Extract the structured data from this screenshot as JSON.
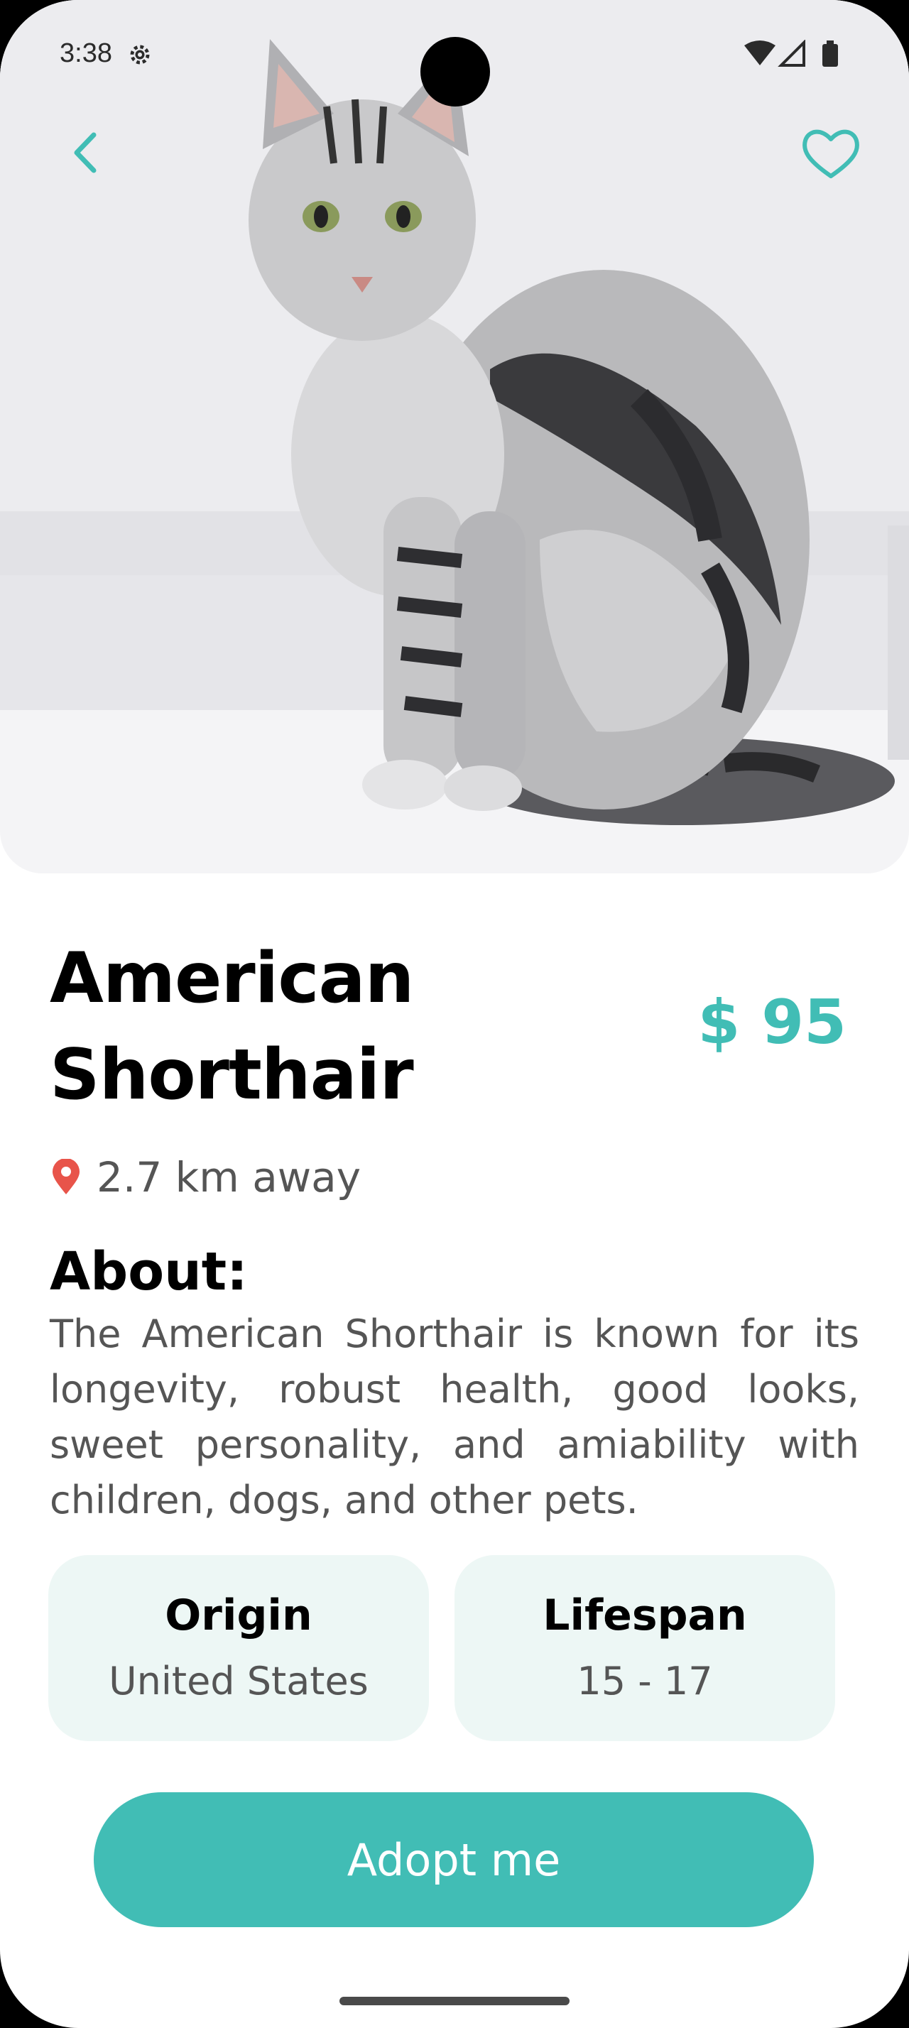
{
  "status_bar": {
    "time": "3:38",
    "icons": [
      "settings-icon",
      "wifi-icon",
      "cellular-icon",
      "battery-icon"
    ]
  },
  "hero": {
    "image": "cat-photo",
    "back_icon": "chevron-left-icon",
    "favorite_icon": "heart-outline-icon"
  },
  "pet": {
    "name": "American Shorthair",
    "price": "$ 95",
    "distance": "2.7 km away",
    "about_heading": "About:",
    "about_text": "The American Shorthair is known for its longevity, robust health, good looks, sweet personality, and amiability with children, dogs, and other pets.",
    "details": [
      {
        "label": "Origin",
        "value": "United States"
      },
      {
        "label": "Lifespan",
        "value": "15 - 17"
      }
    ]
  },
  "actions": {
    "adopt_label": "Adopt me"
  },
  "colors": {
    "accent": "#41bdb5",
    "card_bg": "#edf7f5",
    "pin": "#e8544a",
    "text_muted": "#555555"
  }
}
